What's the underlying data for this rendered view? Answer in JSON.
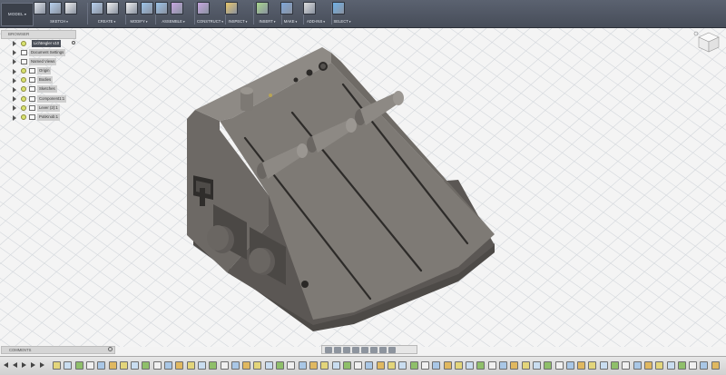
{
  "workspace": "MODEL",
  "toolbar": {
    "groups": [
      {
        "label": "SKETCH",
        "icons": [
          "sketch-pencil-icon",
          "arc-icon",
          "rectangle-icon"
        ]
      },
      {
        "label": "CREATE",
        "icons": [
          "box-icon",
          "sphere-icon"
        ]
      },
      {
        "label": "MODIFY",
        "icons": [
          "press-pull-icon",
          "fillet-icon"
        ]
      },
      {
        "label": "ASSEMBLE",
        "icons": [
          "joint-icon",
          "component-icon"
        ]
      },
      {
        "label": "CONSTRUCT",
        "icons": [
          "plane-icon"
        ]
      },
      {
        "label": "INSPECT",
        "icons": [
          "measure-icon"
        ]
      },
      {
        "label": "INSERT",
        "icons": [
          "insert-image-icon"
        ]
      },
      {
        "label": "MAKE",
        "icons": [
          "3d-print-icon"
        ]
      },
      {
        "label": "ADD-INS",
        "icons": [
          "scripts-icon"
        ]
      },
      {
        "label": "SELECT",
        "icons": [
          "select-arrow-icon"
        ]
      }
    ]
  },
  "browser": {
    "title": "BROWSER",
    "root": "Lichtregler v10",
    "items": [
      {
        "label": "Document Settings",
        "bulb": false
      },
      {
        "label": "Named Views",
        "bulb": false
      },
      {
        "label": "Origin",
        "bulb": true
      },
      {
        "label": "Bodies",
        "bulb": true
      },
      {
        "label": "Sketches",
        "bulb": true
      },
      {
        "label": "Component1:1",
        "bulb": true
      },
      {
        "label": "Lever (2):1",
        "bulb": true
      },
      {
        "label": "PotiKnob:1",
        "bulb": true
      }
    ]
  },
  "comments": {
    "title": "COMMENTS"
  },
  "colors": {
    "toolbar": "#4f5562",
    "model_top": "#8c8883",
    "model_slope": "#7b7772",
    "model_side": "#696561",
    "model_front": "#5a5653",
    "grid": "#d3d7dc",
    "highlight_bulb": "#d8e26f"
  },
  "timeline": {
    "controls": [
      "rewind-icon",
      "step-back-icon",
      "play-icon",
      "step-forward-icon",
      "fast-forward-icon"
    ],
    "feature_count": 60
  }
}
